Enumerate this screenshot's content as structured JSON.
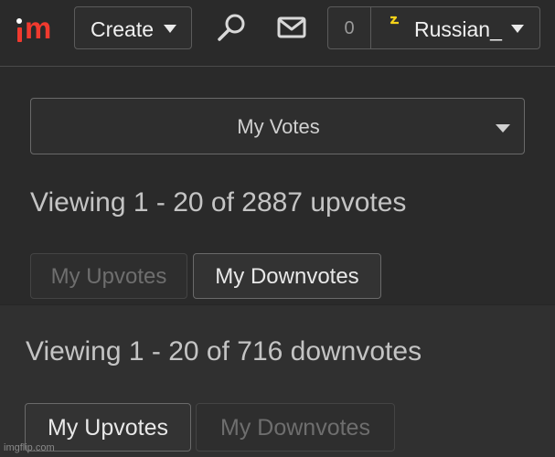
{
  "nav": {
    "logo_letters": "im",
    "create_label": "Create",
    "notification_count": "0",
    "username": "Russian_"
  },
  "votes": {
    "select_label": "My Votes",
    "upvotes_view": {
      "summary": "Viewing 1 - 20 of 2887 upvotes",
      "tab_upvotes": "My Upvotes",
      "tab_downvotes": "My Downvotes"
    },
    "downvotes_view": {
      "summary": "Viewing 1 - 20 of 716 downvotes",
      "tab_upvotes": "My Upvotes",
      "tab_downvotes": "My Downvotes"
    }
  },
  "watermark": "imgflip.com",
  "colors": {
    "brand": "#f03a2f",
    "badge": "#f5d21a"
  },
  "icons": [
    "imgflip-logo",
    "chevron-down-icon",
    "search-icon",
    "mail-icon",
    "user-badge-icon"
  ]
}
